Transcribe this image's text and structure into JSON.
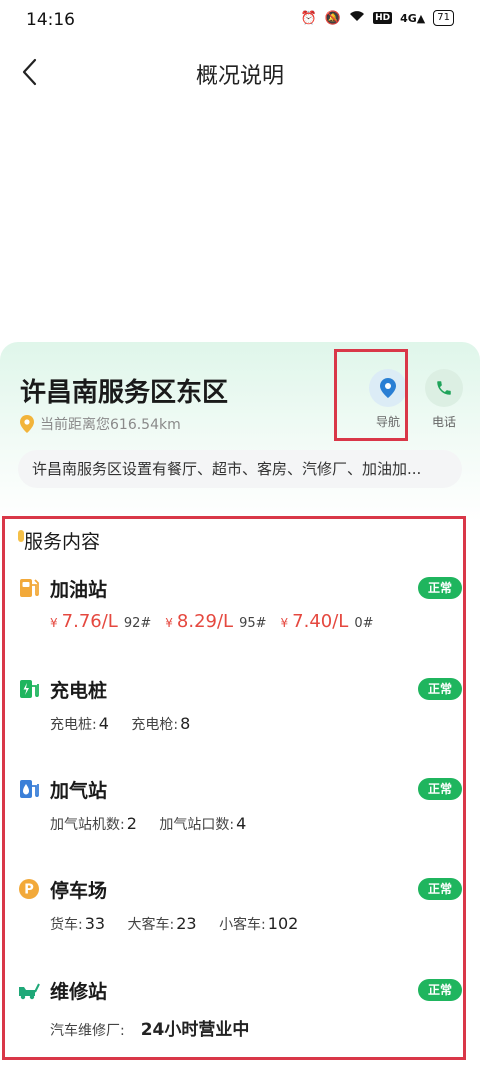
{
  "status": {
    "time": "14:16",
    "battery": "71"
  },
  "header": {
    "title": "概况说明"
  },
  "station": {
    "name": "许昌南服务区东区",
    "distance": "当前距离您616.54km",
    "description": "许昌南服务区设置有餐厅、超市、客房、汽修厂、加油加..."
  },
  "actions": {
    "nav_label": "导航",
    "phone_label": "电话"
  },
  "services": {
    "title": "服务内容",
    "gas": {
      "name": "加油站",
      "status": "正常",
      "prices": [
        {
          "yen": "¥",
          "price": "7.76/L",
          "grade": "92#"
        },
        {
          "yen": "¥",
          "price": "8.29/L",
          "grade": "95#"
        },
        {
          "yen": "¥",
          "price": "7.40/L",
          "grade": "0#"
        }
      ]
    },
    "charging": {
      "name": "充电桩",
      "status": "正常",
      "pile_label": "充电桩:",
      "pile_value": "4",
      "gun_label": "充电枪:",
      "gun_value": "8"
    },
    "cng": {
      "name": "加气站",
      "status": "正常",
      "machines_label": "加气站机数:",
      "machines_value": "2",
      "ports_label": "加气站口数:",
      "ports_value": "4"
    },
    "parking": {
      "name": "停车场",
      "status": "正常",
      "truck_label": "货车:",
      "truck_value": "33",
      "bus_label": "大客车:",
      "bus_value": "23",
      "car_label": "小客车:",
      "car_value": "102"
    },
    "repair": {
      "name": "维修站",
      "status": "正常",
      "label": "汽车维修厂:",
      "value": "24小时营业中"
    }
  },
  "colors": {
    "accent_green": "#1fb55e",
    "price_red": "#e5483f",
    "highlight_red": "#d93748",
    "nav_blue": "#2a7fd4"
  }
}
